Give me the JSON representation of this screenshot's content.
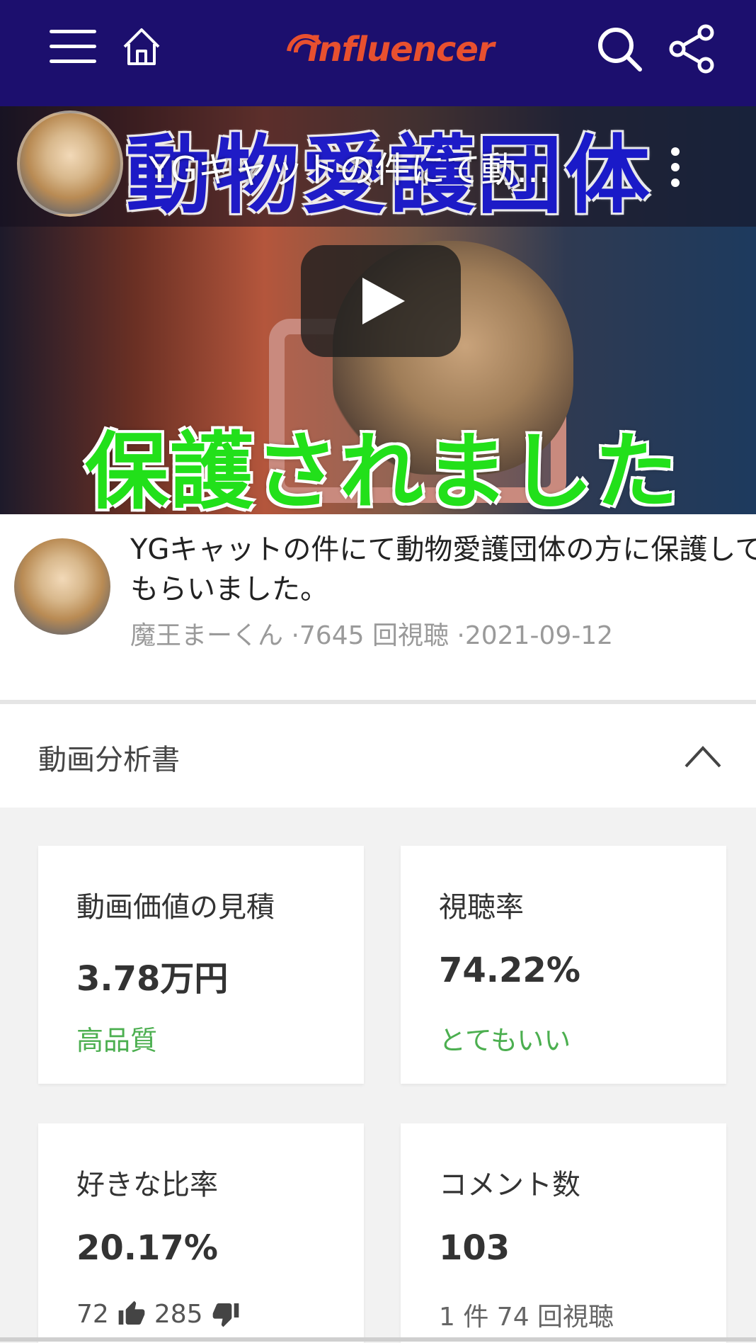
{
  "header": {
    "brand": "influencer",
    "icons": [
      "menu-icon",
      "home-icon",
      "search-icon",
      "share-icon"
    ],
    "background": "#1c0f6e",
    "brand_color": "#e8502f"
  },
  "video": {
    "overlay_title": "YGキャットの件にて動...",
    "thumbnail_headline": "動物愛護団体",
    "thumbnail_subline": "保護されました"
  },
  "info": {
    "title": "YGキャットの件にて動物愛護団体の方に保護してもらいました。",
    "meta": "魔王まーくん ·7645 回視聴 ·2021-09-12"
  },
  "analysis": {
    "heading": "動画分析書",
    "cards": [
      {
        "label": "動画価値の見積",
        "value": "3.78万円",
        "note": "高品質"
      },
      {
        "label": "視聴率",
        "value": "74.22%",
        "note": "とてもいい"
      },
      {
        "label": "好きな比率",
        "value": "20.17%",
        "likes": "72",
        "dislikes": "285"
      },
      {
        "label": "コメント数",
        "value": "103",
        "note": "1 件 74 回視聴"
      }
    ],
    "good_color": "#4caf50"
  }
}
